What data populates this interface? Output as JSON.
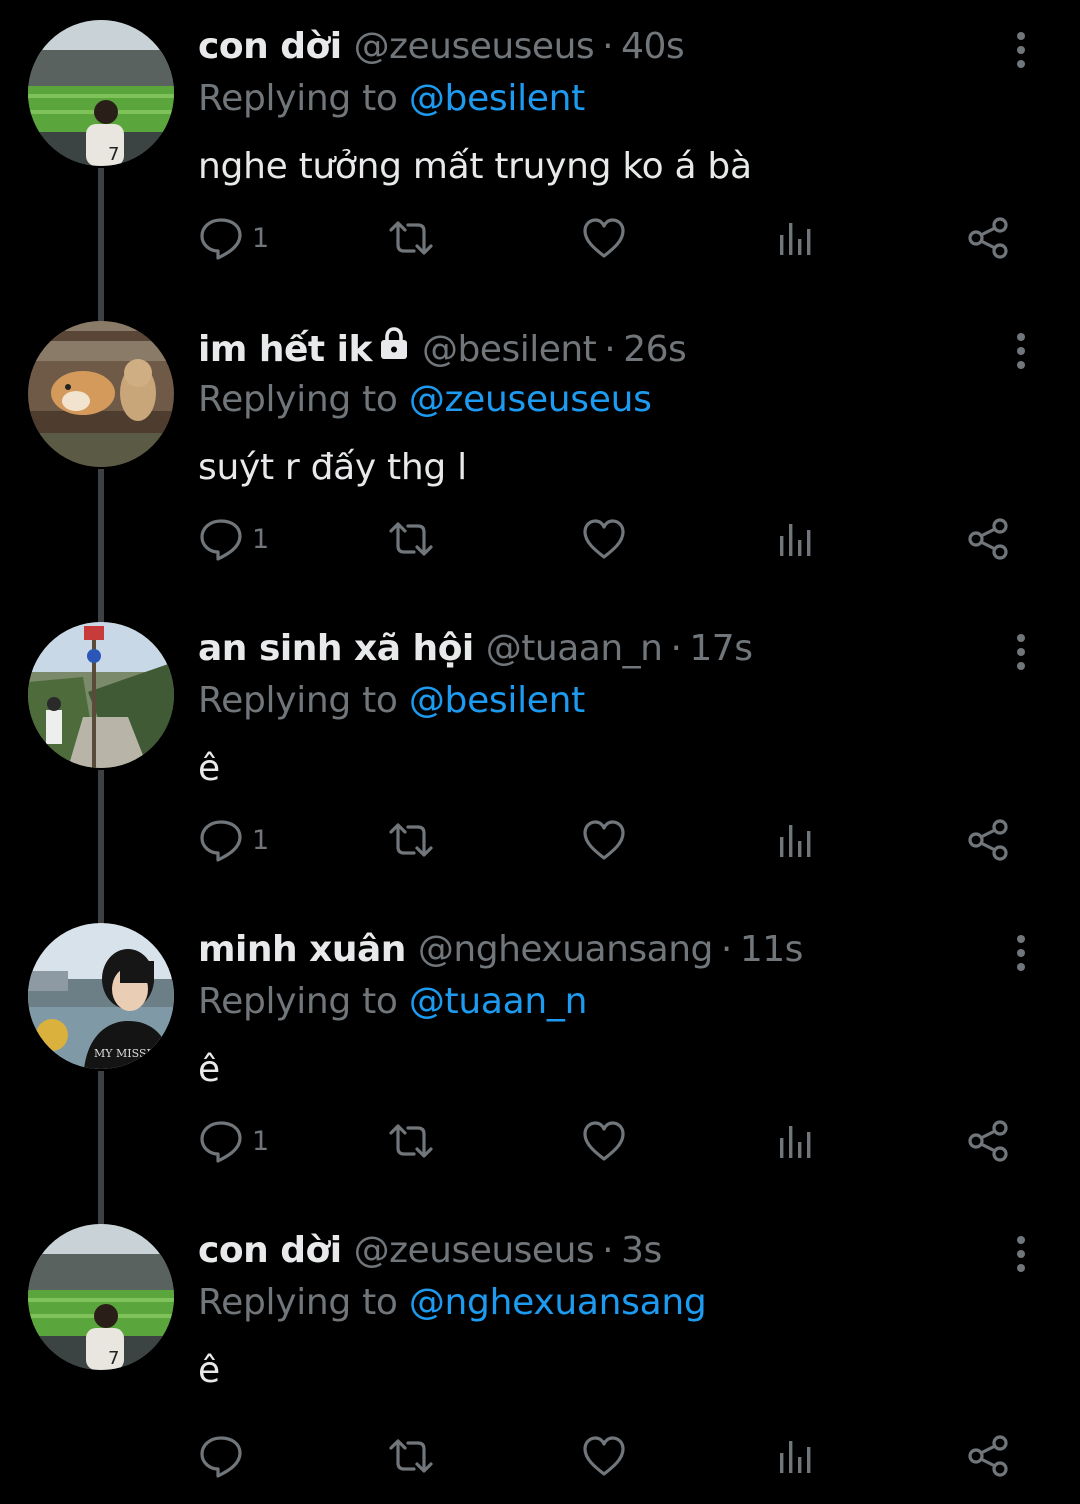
{
  "thread": {
    "replying_prefix": "Replying to",
    "tweets": [
      {
        "name": "con dời",
        "handle": "@zeuseuseus",
        "separator": "·",
        "time": "40s",
        "replying_to": "@besilent",
        "text": "nghe tưởng mất truyng ko á bà",
        "reply_count": "1",
        "locked": false,
        "avatar_icon": "stadium-photo"
      },
      {
        "name": "im hết ik",
        "handle": "@besilent",
        "separator": "·",
        "time": "26s",
        "replying_to": "@zeuseuseus",
        "text": "suýt r đấy thg l",
        "reply_count": "1",
        "locked": true,
        "avatar_icon": "dog-and-cat-photo"
      },
      {
        "name": "an sinh xã hội",
        "handle": "@tuaan_n",
        "separator": "·",
        "time": "17s",
        "replying_to": "@besilent",
        "text": "ê",
        "reply_count": "1",
        "locked": false,
        "avatar_icon": "street-photo"
      },
      {
        "name": "minh xuân",
        "handle": "@nghexuansang",
        "separator": "·",
        "time": "11s",
        "replying_to": "@tuaan_n",
        "text": "ê",
        "reply_count": "1",
        "locked": false,
        "avatar_icon": "portrait-photo"
      },
      {
        "name": "con dời",
        "handle": "@zeuseuseus",
        "separator": "·",
        "time": "3s",
        "replying_to": "@nghexuansang",
        "text": "ê",
        "reply_count": "",
        "locked": false,
        "avatar_icon": "stadium-photo"
      }
    ]
  },
  "colors": {
    "background": "#000000",
    "primary_text": "#e7e9ea",
    "secondary_text": "#71767b",
    "mention": "#1d9bf0",
    "thread_line": "#3e4144"
  },
  "icons": [
    "reply-icon",
    "retweet-icon",
    "like-icon",
    "views-icon",
    "share-icon",
    "more-options-icon",
    "lock-icon"
  ]
}
